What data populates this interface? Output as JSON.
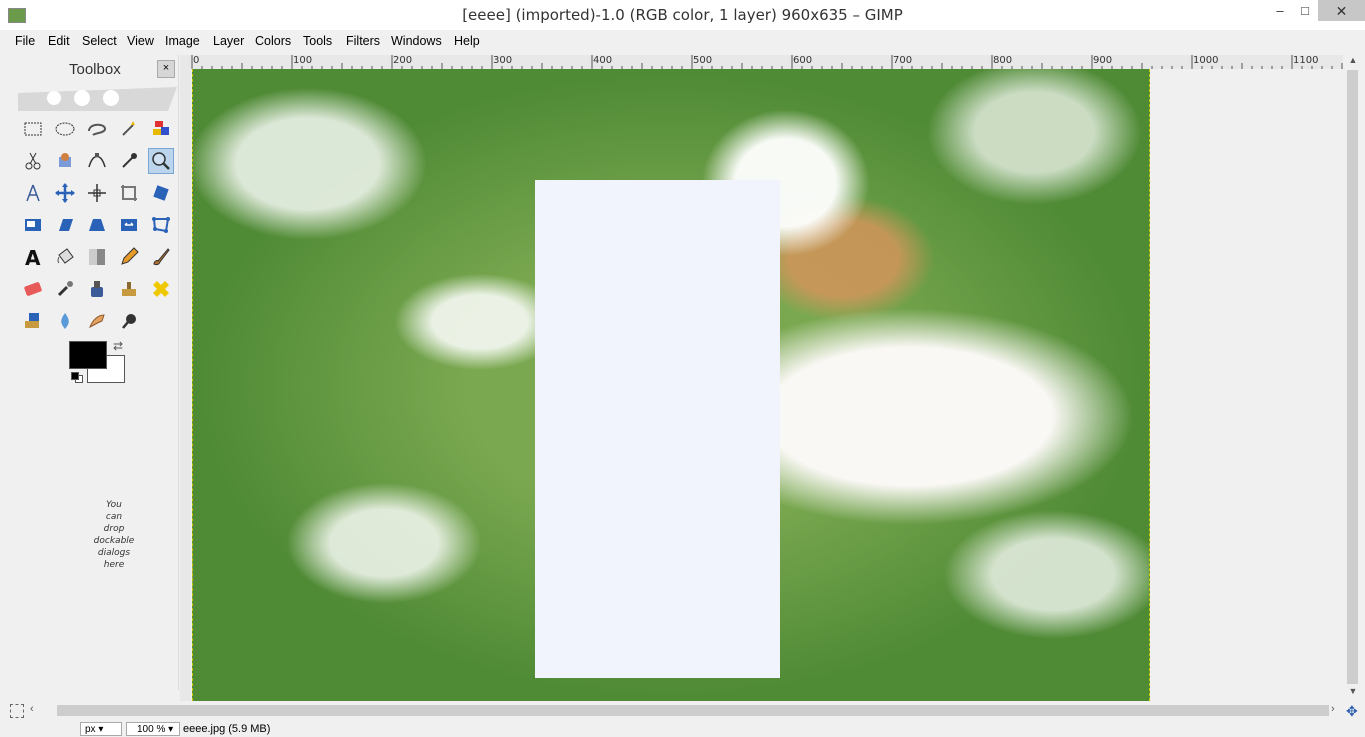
{
  "window": {
    "title": "[eeee] (imported)-1.0 (RGB color, 1 layer) 960x635 – GIMP",
    "minimize": "–",
    "maximize": "□",
    "close": "✕"
  },
  "menubar": {
    "items": [
      "File",
      "Edit",
      "Select",
      "View",
      "Image",
      "Layer",
      "Colors",
      "Tools",
      "Filters",
      "Windows",
      "Help"
    ]
  },
  "toolbox": {
    "title": "Toolbox",
    "close": "×",
    "drop_hint": [
      "You",
      "can",
      "drop",
      "dockable",
      "dialogs",
      "here"
    ],
    "tools": [
      "rect-select",
      "ellipse-select",
      "free-select",
      "fuzzy-select",
      "select-by-color",
      "scissors-select",
      "foreground-select",
      "paths",
      "color-picker",
      "zoom",
      "measure",
      "move",
      "alignment",
      "crop",
      "rotate",
      "scale",
      "shear",
      "perspective",
      "flip",
      "cage-transform",
      "text",
      "bucket-fill",
      "blend",
      "pencil",
      "paintbrush",
      "eraser",
      "airbrush",
      "ink",
      "clone",
      "heal",
      "perspective-clone",
      "blur-sharpen",
      "smudge",
      "dodge-burn"
    ],
    "selected_tool": "zoom",
    "foreground_color": "#000000",
    "background_color": "#ffffff"
  },
  "rulers": {
    "horizontal": [
      "0",
      "100",
      "200",
      "300",
      "400",
      "500",
      "600",
      "700",
      "800",
      "900",
      "1000",
      "1100"
    ]
  },
  "statusbar": {
    "unit": "px",
    "zoom": "100 %",
    "info": "eeee.jpg (5.9 MB)"
  }
}
